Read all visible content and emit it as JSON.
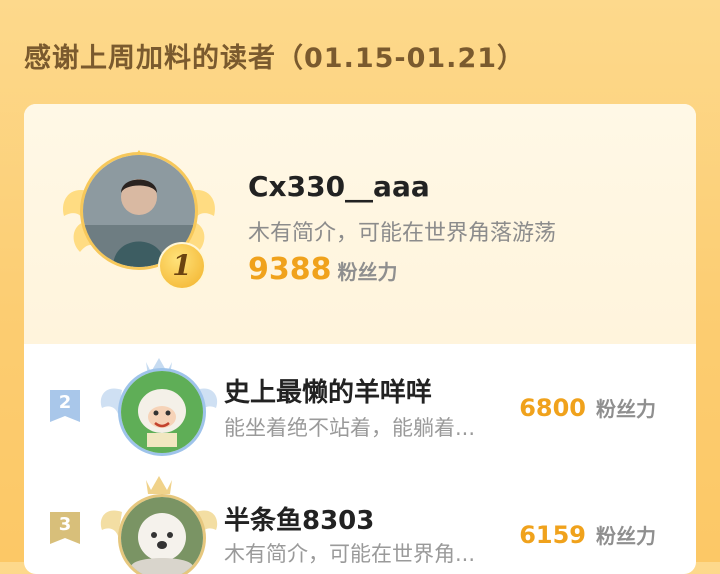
{
  "header": {
    "title": "感谢上周加料的读者（01.15-01.21）"
  },
  "top_reader": {
    "rank": "1",
    "name": "Cx330__aaa",
    "bio": "木有简介，可能在世界角落游荡",
    "fans": "9388",
    "fans_unit": "粉丝力"
  },
  "readers": [
    {
      "rank": "2",
      "name": "史上最懒的羊咩咩",
      "bio": "能坐着绝不站着，能躺着...",
      "fans": "6800",
      "fans_unit": "粉丝力"
    },
    {
      "rank": "3",
      "name": "半条鱼8303",
      "bio": "木有简介，可能在世界角...",
      "fans": "6159",
      "fans_unit": "粉丝力"
    }
  ],
  "colors": {
    "accent": "#f0a21c",
    "background": "#fcd27c",
    "title": "#7a5a2e"
  }
}
